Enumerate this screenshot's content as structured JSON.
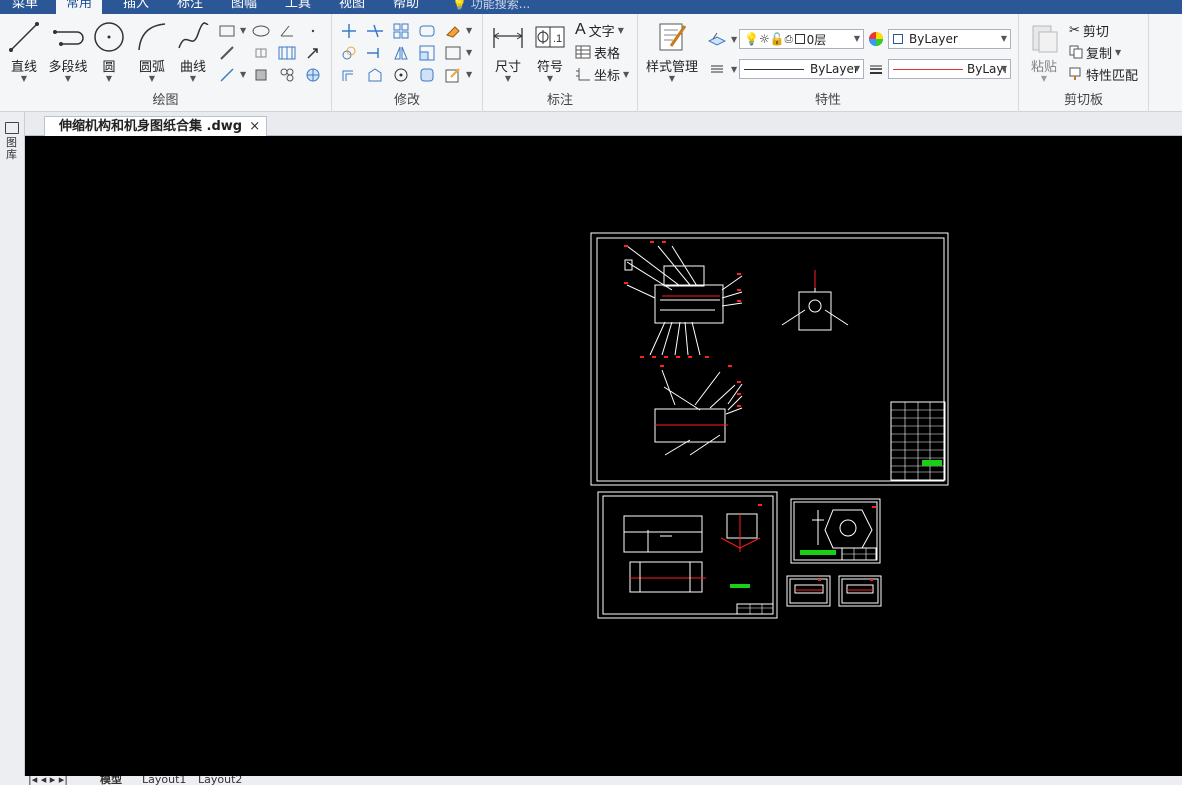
{
  "menu": {
    "tabs": [
      {
        "label": "菜单"
      },
      {
        "label": "常用"
      },
      {
        "label": "插入"
      },
      {
        "label": "标注"
      },
      {
        "label": "图幅"
      },
      {
        "label": "工具"
      },
      {
        "label": "视图"
      },
      {
        "label": "帮助"
      }
    ],
    "active_tab": "常用",
    "search_placeholder": "功能搜索..."
  },
  "ribbon": {
    "draw": {
      "title": "绘图",
      "line": "直线",
      "polyline": "多段线",
      "circle": "圆",
      "arc": "圆弧",
      "curve": "曲线"
    },
    "modify": {
      "title": "修改"
    },
    "annotate": {
      "title": "标注",
      "dimension": "尺寸",
      "symbol": "符号",
      "text": "文字",
      "table": "表格",
      "coord": "坐标"
    },
    "properties": {
      "title": "特性",
      "style_manager": "样式管理",
      "layer_value": "0层",
      "color_value": "ByLayer",
      "linetype_value": "ByLayer",
      "lineweight_value": "ByLayı"
    },
    "clipboard": {
      "title": "剪切板",
      "paste": "粘贴",
      "cut": "剪切",
      "copy": "复制",
      "match_prop": "特性匹配"
    }
  },
  "document": {
    "tab_title": "伸缩机构和机身图纸合集 .dwg",
    "close_glyph": "×"
  },
  "sidebar": {
    "label": "图库"
  },
  "layout_tabs": [
    {
      "label": "模型"
    },
    {
      "label": "Layout1"
    },
    {
      "label": "Layout2"
    }
  ],
  "colors": {
    "ribbon_tab_bar": "#2b5797",
    "canvas_bg": "#000000",
    "drawing_line": "#ffffff",
    "dimension_red": "#ff2020",
    "title_green": "#19d019"
  }
}
